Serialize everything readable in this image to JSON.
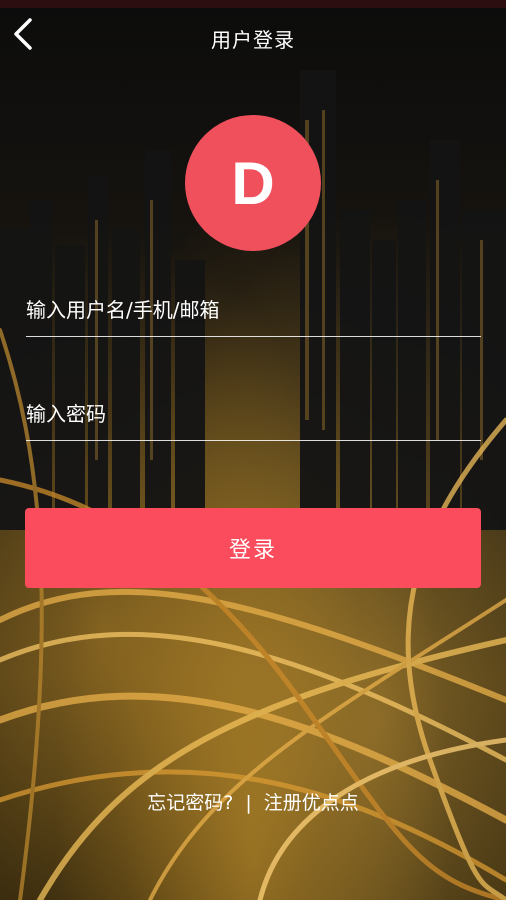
{
  "header": {
    "title": "用户登录",
    "back_icon": "chevron-left-icon"
  },
  "avatar": {
    "letter": "D",
    "color": "#f0505c"
  },
  "form": {
    "username_placeholder": "输入用户名/手机/邮箱",
    "username_value": "",
    "password_placeholder": "输入密码",
    "password_value": "",
    "login_label": "登录",
    "login_color": "#fb4c5d"
  },
  "footer": {
    "forgot_password": "忘记密码?",
    "separator": "|",
    "register": "注册优点点"
  }
}
